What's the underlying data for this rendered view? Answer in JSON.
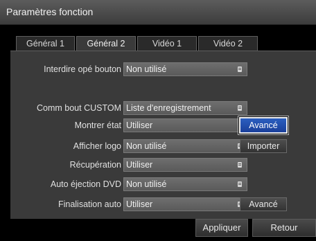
{
  "window": {
    "title": "Paramètres fonction"
  },
  "tabs": [
    {
      "label": "Général 1",
      "active": false
    },
    {
      "label": "Général 2",
      "active": true
    },
    {
      "label": "Vidéo 1",
      "active": false
    },
    {
      "label": "Vidéo 2",
      "active": false
    }
  ],
  "settings": [
    {
      "label": "Interdire opé bouton",
      "value": "Non utilisé"
    },
    {
      "label": "Comm bout CUSTOM",
      "value": "Liste d'enregistrement"
    },
    {
      "label": "Montrer état",
      "value": "Utiliser",
      "button": "Avancé",
      "button_focused": true
    },
    {
      "label": "Afficher logo",
      "value": "Non utilisé",
      "button": "Importer"
    },
    {
      "label": "Récupération",
      "value": "Utiliser"
    },
    {
      "label": "Auto éjection DVD",
      "value": "Non utilisé"
    },
    {
      "label": "Finalisation auto",
      "value": "Utiliser",
      "button": "Avancé"
    }
  ],
  "footer": {
    "apply_label": "Appliquer",
    "back_label": "Retour"
  },
  "colors": {
    "focus": "#2b5fc0",
    "panel": "#3a3a3a",
    "select": "#666666"
  }
}
